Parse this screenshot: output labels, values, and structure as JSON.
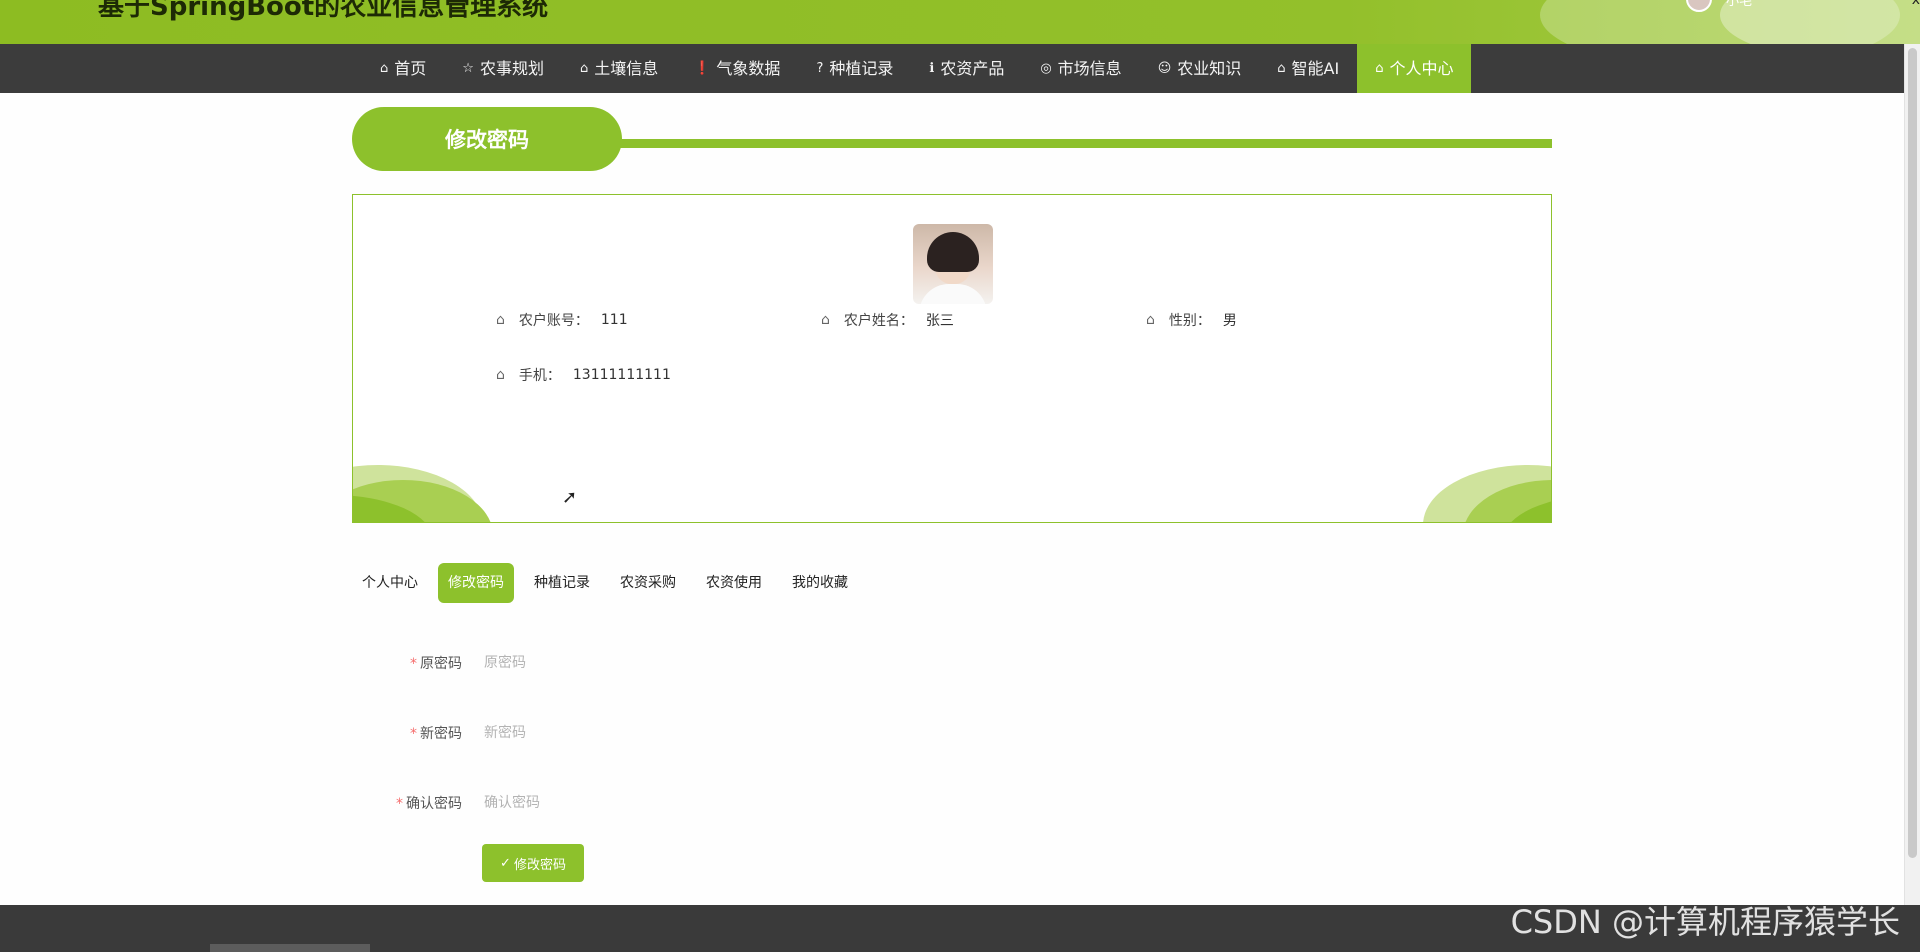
{
  "header": {
    "title": "基于SpringBoot的农业信息管理系统",
    "username": "小毛",
    "close_glyph": "x"
  },
  "nav": {
    "items": [
      {
        "icon": "⌂",
        "label": "首页"
      },
      {
        "icon": "☆",
        "label": "农事规划"
      },
      {
        "icon": "⌂",
        "label": "土壤信息"
      },
      {
        "icon": "❗",
        "label": "气象数据"
      },
      {
        "icon": "?",
        "label": "种植记录"
      },
      {
        "icon": "ℹ",
        "label": "农资产品"
      },
      {
        "icon": "◎",
        "label": "市场信息"
      },
      {
        "icon": "☺",
        "label": "农业知识"
      },
      {
        "icon": "⌂",
        "label": "智能AI"
      },
      {
        "icon": "⌂",
        "label": "个人中心"
      }
    ],
    "active_index": 9
  },
  "section": {
    "title": "修改密码"
  },
  "profile": {
    "fields": [
      {
        "icon": "⌂",
        "label": "农户账号：",
        "value": "111"
      },
      {
        "icon": "⌂",
        "label": "农户姓名：",
        "value": "张三"
      },
      {
        "icon": "⌂",
        "label": "性别：",
        "value": "男"
      },
      {
        "icon": "⌂",
        "label": "手机：",
        "value": "13111111111"
      }
    ]
  },
  "tabs": {
    "items": [
      "个人中心",
      "修改密码",
      "种植记录",
      "农资采购",
      "农资使用",
      "我的收藏"
    ],
    "active_index": 1
  },
  "form": {
    "fields": [
      {
        "required": "*",
        "label": "原密码",
        "placeholder": "原密码"
      },
      {
        "required": "*",
        "label": "新密码",
        "placeholder": "新密码"
      },
      {
        "required": "*",
        "label": "确认密码",
        "placeholder": "确认密码"
      }
    ],
    "submit_icon": "✓",
    "submit_label": "修改密码"
  },
  "watermark": "CSDN @计算机程序猿学长",
  "colors": {
    "brand_green": "#8dc12c",
    "nav_bg": "#3c3c3c",
    "required_red": "#f56c6c"
  }
}
